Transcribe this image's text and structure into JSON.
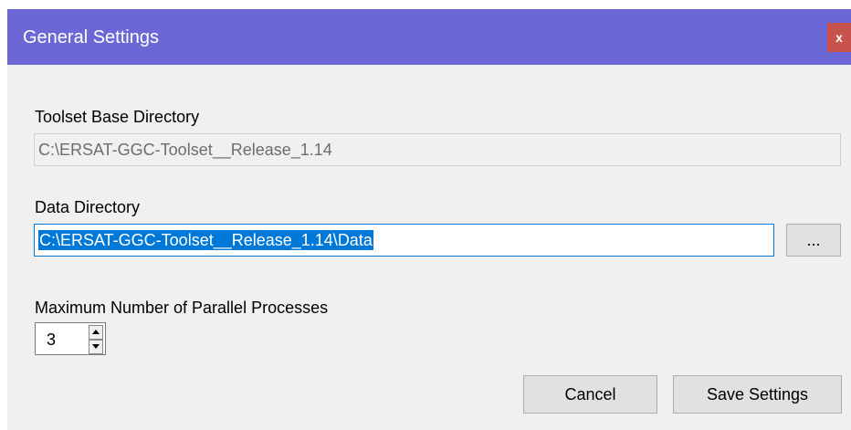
{
  "window": {
    "title": "General Settings",
    "close_glyph": "x"
  },
  "toolset_base_dir": {
    "label": "Toolset Base Directory",
    "value": "C:\\ERSAT-GGC-Toolset__Release_1.14"
  },
  "data_dir": {
    "label": "Data Directory",
    "value": "C:\\ERSAT-GGC-Toolset__Release_1.14\\Data",
    "browse_label": "..."
  },
  "parallel": {
    "label": "Maximum Number of Parallel Processes",
    "value": "3"
  },
  "buttons": {
    "cancel": "Cancel",
    "save": "Save Settings"
  },
  "colors": {
    "titlebar": "#6b68d6",
    "close": "#c8524c",
    "selection": "#0078d7",
    "dialog_bg": "#f0f0f0"
  },
  "icons": {
    "close": "close-icon",
    "spin_up": "triangle-up-icon",
    "spin_down": "triangle-down-icon"
  }
}
